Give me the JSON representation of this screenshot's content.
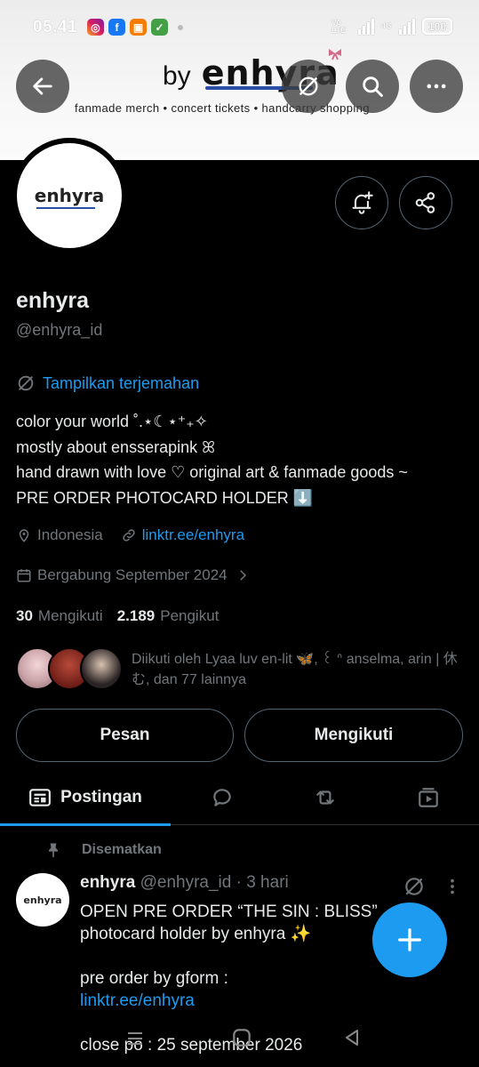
{
  "status_bar": {
    "time": "05.41",
    "network": "4G",
    "volte": "Vo LTE",
    "battery": "100"
  },
  "banner": {
    "by_text": "by",
    "logo_text": "enhyra",
    "tagline": "fanmade merch • concert tickets • handcarry shopping"
  },
  "profile": {
    "avatar_text": "enhyra",
    "name": "enhyra",
    "handle": "@enhyra_id",
    "translate_label": "Tampilkan terjemahan",
    "bio_lines": [
      "color your world ˚.⋆☾⋆⁺₊✧",
      "mostly about ensserapink ꕤ",
      "hand drawn with love ♡ original art & fanmade goods ~",
      "PRE ORDER PHOTOCARD HOLDER ⬇️"
    ],
    "location": "Indonesia",
    "link": "linktr.ee/enhyra",
    "joined": "Bergabung September 2024",
    "following_count": "30",
    "following_label": "Mengikuti",
    "followers_count": "2.189",
    "followers_label": "Pengikut",
    "followed_by_text": "Diikuti oleh Lyaa luv en-lit 🦋, ꒰ ᐢ anselma, arin | 休む, dan 77 lainnya"
  },
  "buttons": {
    "message": "Pesan",
    "following": "Mengikuti"
  },
  "tabs": [
    {
      "label": "Postingan",
      "icon": "posts-icon"
    },
    {
      "label": "",
      "icon": "replies-icon"
    },
    {
      "label": "",
      "icon": "reposts-icon"
    },
    {
      "label": "",
      "icon": "media-icon"
    }
  ],
  "pinned_post": {
    "pinned_label": "Disematkan",
    "author": "enhyra",
    "handle_time": "@enhyra_id · 3 hari",
    "avatar_text": "enhyra",
    "line1": "OPEN PRE ORDER “THE SIN : BLISS”",
    "line2": "photocard holder by enhyra ✨",
    "line3": "pre order by gform :",
    "link": "linktr.ee/enhyra",
    "line4": "close po : 25 september 2026"
  },
  "colors": {
    "accent": "#1d9bf0",
    "muted": "#71767b",
    "text": "#e7e9ea",
    "border": "#536471"
  }
}
